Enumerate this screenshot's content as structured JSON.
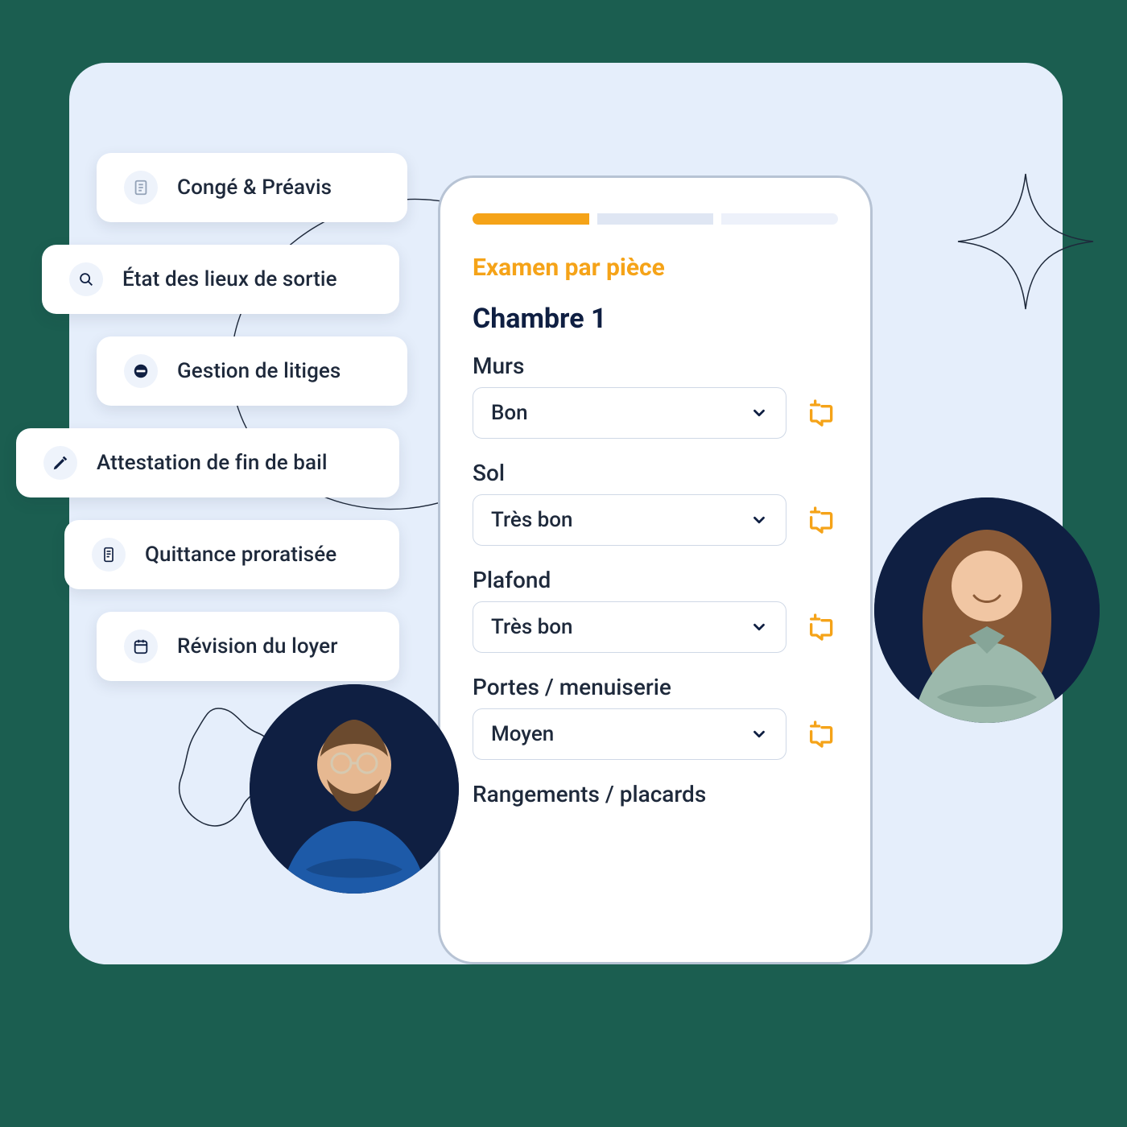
{
  "menu": {
    "items": [
      {
        "label": "Congé & Préavis"
      },
      {
        "label": "État des lieux de sortie"
      },
      {
        "label": "Gestion de litiges"
      },
      {
        "label": "Attestation de fin de bail"
      },
      {
        "label": "Quittance proratisée"
      },
      {
        "label": "Révision du loyer"
      }
    ]
  },
  "device": {
    "title": "Examen par pièce",
    "room": "Chambre 1",
    "progress": {
      "completed": 1,
      "current": 1,
      "total": 3
    },
    "fields": [
      {
        "label": "Murs",
        "value": "Bon"
      },
      {
        "label": "Sol",
        "value": "Très bon"
      },
      {
        "label": "Plafond",
        "value": "Très bon"
      },
      {
        "label": "Portes / menuiserie",
        "value": "Moyen"
      },
      {
        "label": "Rangements / placards",
        "value": ""
      }
    ]
  },
  "colors": {
    "accent": "#f5a318",
    "navy": "#0f1f42",
    "panel": "#e5eefb"
  }
}
